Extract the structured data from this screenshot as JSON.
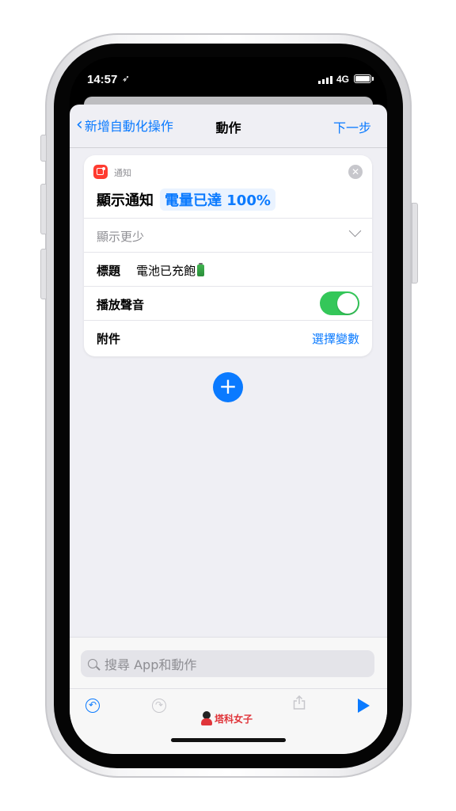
{
  "status_bar": {
    "time": "14:57",
    "network": "4G"
  },
  "nav": {
    "back_label": "新增自動化操作",
    "title": "動作",
    "next_label": "下一步"
  },
  "card": {
    "app_name": "通知",
    "action_label": "顯示通知",
    "action_token": "電量已達 100%",
    "show_less_label": "顯示更少",
    "title_label": "標題",
    "title_value": "電池已充飽",
    "sound_label": "播放聲音",
    "sound_enabled": true,
    "attachment_label": "附件",
    "attachment_value": "選擇變數"
  },
  "search": {
    "placeholder": "搜尋 App和動作"
  },
  "watermark": {
    "text": "塔科女子"
  },
  "colors": {
    "accent": "#0a7aff",
    "toggle_on": "#34c759",
    "notify_icon": "#ff3b30"
  }
}
